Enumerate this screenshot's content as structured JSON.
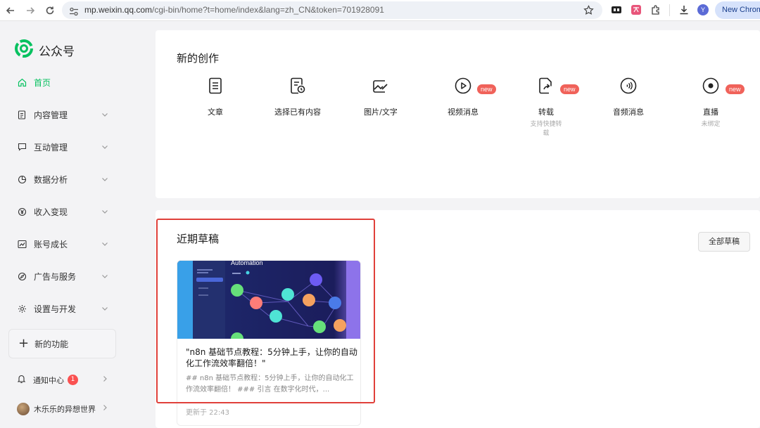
{
  "browser": {
    "url_host": "mp.weixin.qq.com",
    "url_path": "/cgi-bin/home?t=home/index&lang=zh_CN&token=701928091",
    "profile_initial": "Y",
    "new_chrome_label": "New Chrom"
  },
  "sidebar": {
    "logo_text": "公众号",
    "items": [
      {
        "label": "首页",
        "icon": "home-icon",
        "active": true
      },
      {
        "label": "内容管理",
        "icon": "document-icon"
      },
      {
        "label": "互动管理",
        "icon": "chat-icon"
      },
      {
        "label": "数据分析",
        "icon": "pie-chart-icon"
      },
      {
        "label": "收入变现",
        "icon": "yen-icon"
      },
      {
        "label": "账号成长",
        "icon": "trend-icon"
      },
      {
        "label": "广告与服务",
        "icon": "compass-icon"
      },
      {
        "label": "设置与开发",
        "icon": "gear-icon"
      }
    ],
    "new_features_label": "新的功能",
    "notification_label": "通知中心",
    "notification_count": "1",
    "account_name": "木乐乐的异想世界"
  },
  "create": {
    "title": "新的创作",
    "new_tag": "new",
    "tools": [
      {
        "label": "文章",
        "sub": "",
        "icon": "article-icon"
      },
      {
        "label": "选择已有内容",
        "sub": "",
        "icon": "existing-content-icon"
      },
      {
        "label": "图片/文字",
        "sub": "",
        "icon": "image-text-icon"
      },
      {
        "label": "视频消息",
        "sub": "",
        "icon": "video-play-icon"
      },
      {
        "label": "转载",
        "sub": "支持快捷转载",
        "icon": "repost-icon"
      },
      {
        "label": "音频消息",
        "sub": "",
        "icon": "audio-icon"
      },
      {
        "label": "直播",
        "sub": "未绑定",
        "icon": "live-icon"
      }
    ]
  },
  "drafts": {
    "title": "近期草稿",
    "all_button": "全部草稿",
    "items": [
      {
        "thumb_heading": "Automation",
        "title": "\"n8n 基础节点教程：5分钟上手，让你的自动化工作流效率翻倍！\"",
        "desc": "## n8n 基础节点教程：5分钟上手，让你的自动化工作流效率翻倍！ ### 引言 在数字化时代，...",
        "updated": "更新于 22:43"
      }
    ]
  },
  "colors": {
    "brand_green": "#07c160",
    "new_tag_red": "#f0625a",
    "highlight_red": "#e0403a"
  }
}
